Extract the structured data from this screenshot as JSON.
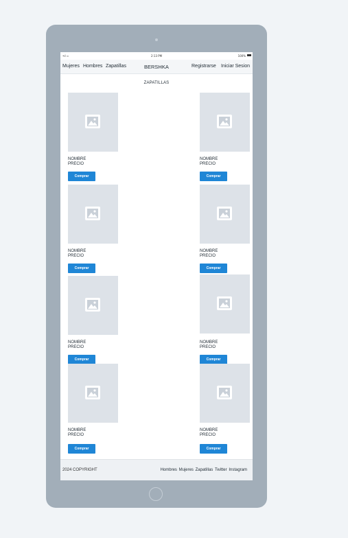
{
  "status_bar": {
    "signal": "•ıl ≈",
    "time": "2:13 PM",
    "battery": "100%"
  },
  "nav": {
    "links": [
      "Mujeres",
      "Hombres",
      "Zapatillas"
    ],
    "brand": "BERSHKA",
    "register": "Registrarse",
    "login": "Iniciar Sesion"
  },
  "section_title": "ZAPATILLAS",
  "products": [
    {
      "name": "NOMBRE",
      "price": "PRECIO",
      "button": "Comprar"
    },
    {
      "name": "NOMBRE",
      "price": "PRECIO",
      "button": "Comprar"
    },
    {
      "name": "NOMBRE",
      "price": "PRECIO",
      "button": "Comprar"
    },
    {
      "name": "NOMBRE",
      "price": "PRECIO",
      "button": "Comprar"
    },
    {
      "name": "NOMBRE",
      "price": "PRECIO",
      "button": "Comprar"
    },
    {
      "name": "NOMBRE",
      "price": "PRECIO",
      "button": "Comprar"
    },
    {
      "name": "NOMBRE",
      "price": "PRECIO",
      "button": "Comprar"
    },
    {
      "name": "NOMBRE",
      "price": "PRECIO",
      "button": "Comprar"
    }
  ],
  "footer": {
    "copyright": "2024 COPYRIGHT",
    "links": [
      "Hombres",
      "Mujeres",
      "Zapatillas",
      "Twitter",
      "Instagram"
    ]
  },
  "colors": {
    "accent": "#1f86d6",
    "placeholder": "#dde2e8",
    "frame": "#a2aeb9"
  },
  "icons": {
    "product_image": "image-placeholder-icon"
  }
}
